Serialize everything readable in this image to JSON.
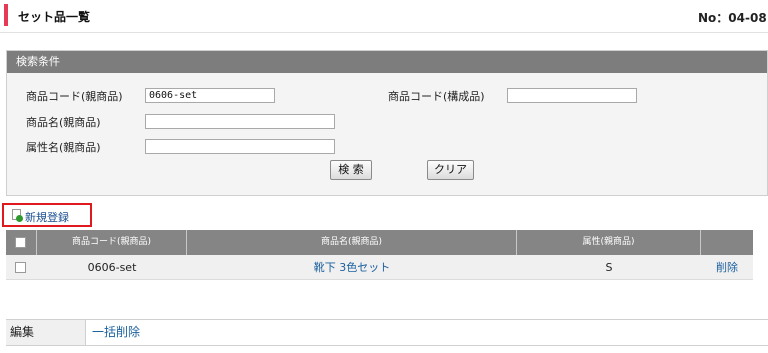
{
  "header": {
    "title": "セット品一覧",
    "page_no": "No：04-08"
  },
  "search": {
    "panel_title": "検索条件",
    "parent_code_label": "商品コード(親商品)",
    "parent_code_value": "0606-set",
    "component_code_label": "商品コード(構成品)",
    "component_code_value": "",
    "parent_name_label": "商品名(親商品)",
    "parent_name_value": "",
    "attribute_name_label": "属性名(親商品)",
    "attribute_name_value": "",
    "search_button": "検 索",
    "clear_button": "クリア"
  },
  "actions": {
    "new_registration": "新規登録"
  },
  "table": {
    "columns": [
      "商品コード(親商品)",
      "商品名(親商品)",
      "属性(親商品)"
    ],
    "rows": [
      {
        "code": "0606-set",
        "name": "靴下 3色セット",
        "attribute": "S",
        "delete": "削除"
      }
    ]
  },
  "footer": {
    "edit_label": "編集",
    "bulk_delete": "一括削除"
  },
  "colors": {
    "accent": "#e53b56",
    "panel_header": "#7d7d7d",
    "table_header": "#858585",
    "link": "#1a5f9e",
    "highlight_border": "#e0191f"
  }
}
